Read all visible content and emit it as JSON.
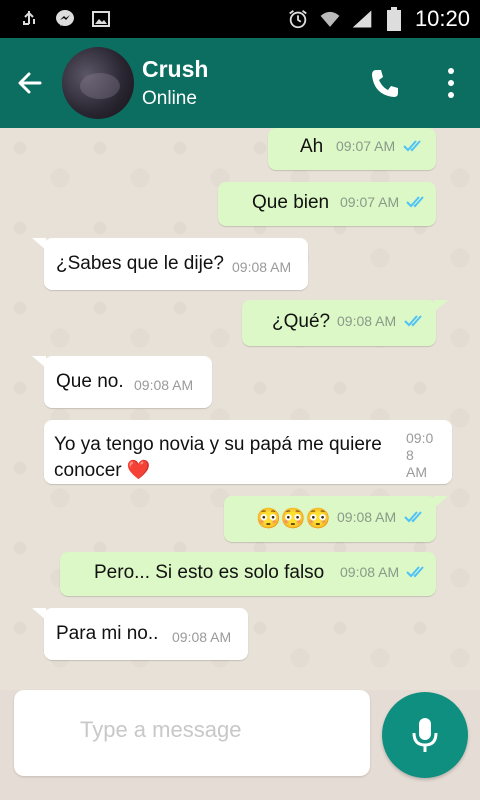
{
  "status_bar": {
    "time": "10:20",
    "icons": [
      "usb-debug-icon",
      "messenger-icon",
      "gallery-icon",
      "alarm-icon",
      "wifi-icon",
      "signal-icon",
      "battery-icon"
    ]
  },
  "header": {
    "contact_name": "Crush",
    "status": "Online",
    "accent": "#0b6e60"
  },
  "messages": [
    {
      "dir": "out",
      "text": "Ah",
      "time": "09:07 AM",
      "ticks": "read"
    },
    {
      "dir": "out",
      "text": "Que bien",
      "time": "09:07 AM",
      "ticks": "read"
    },
    {
      "dir": "in",
      "text": "¿Sabes que le dije?",
      "time": "09:08 AM"
    },
    {
      "dir": "out",
      "text": "¿Qué?",
      "time": "09:08 AM",
      "ticks": "read"
    },
    {
      "dir": "in",
      "text": "Que no.",
      "time": "09:08 AM"
    },
    {
      "dir": "in",
      "text_line1": "Yo ya tengo novia y su papá me quiere",
      "text_line2": "conocer ❤️",
      "time_line1": "09:0",
      "time_line2": "8",
      "time_line3": "AM"
    },
    {
      "dir": "out",
      "text": "😳😳😳",
      "time": "09:08 AM",
      "ticks": "read"
    },
    {
      "dir": "out",
      "text": "Pero... Si esto es solo falso",
      "time": "09:08 AM",
      "ticks": "read"
    },
    {
      "dir": "in",
      "text": "Para mi no..",
      "time": "09:08 AM"
    }
  ],
  "composer": {
    "placeholder": "Type a message"
  },
  "colors": {
    "outgoing_bubble": "#dcf8c6",
    "incoming_bubble": "#ffffff",
    "read_ticks": "#4fc3f7",
    "mic_button": "#0f8f7f"
  }
}
